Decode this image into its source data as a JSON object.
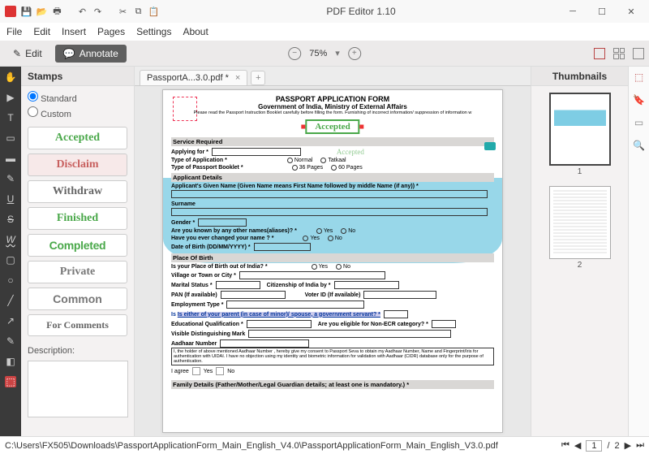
{
  "titlebar": {
    "title": "PDF Editor 1.10"
  },
  "menu": [
    "File",
    "Edit",
    "Insert",
    "Pages",
    "Settings",
    "About"
  ],
  "ribbon": {
    "edit": "Edit",
    "annotate": "Annotate",
    "zoom": "75%"
  },
  "stamps": {
    "title": "Stamps",
    "standard": "Standard",
    "custom": "Custom",
    "items": [
      "Accepted",
      "Disclaim",
      "Withdraw",
      "Finished",
      "Completed",
      "Private",
      "Common",
      "For Comments"
    ],
    "description_label": "Description:"
  },
  "tab": {
    "name": "PassportA...3.0.pdf *"
  },
  "thumbnails": {
    "title": "Thumbnails",
    "page1": "1",
    "page2": "2"
  },
  "status": {
    "path": "C:\\Users\\FX505\\Downloads\\PassportApplicationForm_Main_English_V4.0\\PassportApplicationForm_Main_English_V3.0.pdf",
    "page_current": "1",
    "page_sep": "/",
    "page_total": "2"
  },
  "doc": {
    "title": "PASSPORT APPLICATION FORM",
    "subtitle": "Government of India, Ministry of External Affairs",
    "note": "Please read the Passport Instruction Booklet carefully before filling the form. Furnishing of incorrect information/ suppression of information w",
    "stamp": "Accepted",
    "sec_service": "Service Required",
    "applying": "Applying for *",
    "type_app": "Type of Application *",
    "normal": "Normal",
    "tatkaal": "Tatkaal",
    "type_book": "Type of Passport Booklet *",
    "p36": "36 Pages",
    "p60": "60 Pages",
    "sec_applicant": "Applicant Details",
    "given_name": "Applicant's Given Name (Given Name means First Name followed by middle Name (if any)) *",
    "surname": "Surname",
    "gender": "Gender *",
    "aliases": "Are you known by any other names(aliases)? *",
    "changed": "Have you ever changed your name ? *",
    "yes": "Yes",
    "no": "No",
    "dob": "Date of Birth (DD/MM/YYYY) *",
    "sec_pob": "Place Of Birth",
    "pob_out": "Is your Place of Birth out of India? *",
    "village": "Village or Town or City *",
    "marital": "Marital Status *",
    "citizenship": "Citizenship of India by *",
    "pan": "PAN (If available)",
    "voter": "Voter ID (If available)",
    "employ": "Employment Type *",
    "parent": "Is either of your parent (in case of minor)/ spouse, a government servant? *",
    "edu": "Educational Qualification *",
    "non_ecr": "Are you eligible for Non-ECR category? *",
    "mark": "Visible Distinguishing Mark",
    "aadhaar": "Aadhaar Number",
    "aadhaar_text": "I, the holder of above mentioned Aadhaar Number , hereby give my consent to Passport Seva to obtain my Aadhaar Number, Name and Fingerprint/Iris for authentication with UIDAI. I have no objection using my identity and biometric information for validation with Aadhaar (CIDR) database only for the purpose of authentication.",
    "agree": "I agree",
    "sec_family": "Family Details (Father/Mother/Legal Guardian details; at least one is mandatory.) *"
  }
}
